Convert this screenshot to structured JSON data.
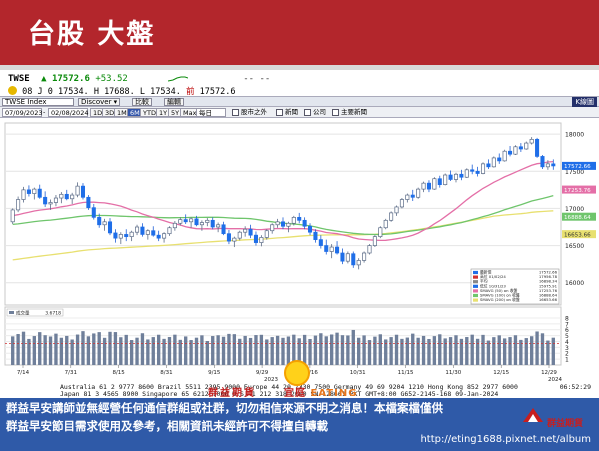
{
  "slide": {
    "title": "台股 大盤"
  },
  "quote": {
    "symbol": "TWSE",
    "last": "17572.6",
    "change": "+53.52",
    "dash": "-- --",
    "line2_prefix": "08 J 0",
    "open_label": "0",
    "open": "17534.",
    "high_label": "H",
    "high": "17688.",
    "low_label": "L",
    "low": "17534.",
    "prev_label": "前",
    "prev": "17572.6"
  },
  "window": {
    "symbol_field": "TWSE Index",
    "discover_button": "Discover",
    "calendar_button": "比較",
    "edit_button": "編輯",
    "k_tab": "K線圖"
  },
  "toolbar": {
    "date_from": "07/09/2023",
    "date_to": "02/08/2024",
    "periods": [
      "1D",
      "3D",
      "1M",
      "6M",
      "YTD",
      "1Y",
      "5Y",
      "Max"
    ],
    "active_period": "6M",
    "frequency": "每日",
    "check1": "股市之外",
    "check2": "新聞",
    "check3": "公司",
    "check4": "主要新聞"
  },
  "chart_data": {
    "type": "candlestick",
    "title": "",
    "price_axis": {
      "ticks": [
        16000,
        16500,
        17000,
        17500,
        18000
      ],
      "ylim": [
        15700,
        18150
      ],
      "labels": [
        "16000",
        "16500",
        "17000",
        "17500",
        "18000"
      ]
    },
    "volume_axis": {
      "ticks": [
        1,
        2,
        3,
        4,
        5,
        6,
        7,
        8
      ],
      "ylim": [
        0,
        8.5
      ],
      "labels": [
        "1",
        "2",
        "3",
        "4",
        "5",
        "6",
        "7",
        "8"
      ]
    },
    "x_labels": [
      "7/14",
      "7/31",
      "8/15",
      "8/31",
      "9/15",
      "9/29",
      "10/16",
      "10/31",
      "11/15",
      "11/30",
      "12/15",
      "12/29"
    ],
    "x_year_labels": [
      "2023",
      "2024"
    ],
    "ohlc": [
      [
        16820,
        17000,
        16790,
        16980
      ],
      [
        16980,
        17160,
        16950,
        17120
      ],
      [
        17120,
        17290,
        17080,
        17250
      ],
      [
        17250,
        17310,
        17160,
        17200
      ],
      [
        17200,
        17280,
        17120,
        17260
      ],
      [
        17260,
        17320,
        17130,
        17150
      ],
      [
        17150,
        17230,
        17020,
        17060
      ],
      [
        17060,
        17120,
        16980,
        17080
      ],
      [
        17080,
        17180,
        17030,
        17140
      ],
      [
        17140,
        17220,
        17070,
        17190
      ],
      [
        17190,
        17250,
        17110,
        17130
      ],
      [
        17130,
        17210,
        17060,
        17180
      ],
      [
        17180,
        17350,
        17150,
        17300
      ],
      [
        17300,
        17340,
        17120,
        17150
      ],
      [
        17150,
        17180,
        16980,
        17010
      ],
      [
        17010,
        17060,
        16850,
        16880
      ],
      [
        16880,
        16930,
        16740,
        16780
      ],
      [
        16780,
        16860,
        16700,
        16820
      ],
      [
        16820,
        16870,
        16640,
        16670
      ],
      [
        16670,
        16720,
        16540,
        16600
      ],
      [
        16600,
        16680,
        16520,
        16650
      ],
      [
        16650,
        16720,
        16560,
        16620
      ],
      [
        16620,
        16700,
        16560,
        16680
      ],
      [
        16680,
        16780,
        16640,
        16750
      ],
      [
        16750,
        16800,
        16620,
        16650
      ],
      [
        16650,
        16720,
        16580,
        16700
      ],
      [
        16700,
        16760,
        16620,
        16640
      ],
      [
        16640,
        16700,
        16560,
        16600
      ],
      [
        16600,
        16680,
        16540,
        16660
      ],
      [
        16660,
        16760,
        16630,
        16740
      ],
      [
        16740,
        16830,
        16700,
        16800
      ],
      [
        16800,
        16880,
        16770,
        16850
      ],
      [
        16850,
        16920,
        16790,
        16820
      ],
      [
        16820,
        16880,
        16740,
        16860
      ],
      [
        16860,
        16900,
        16760,
        16780
      ],
      [
        16780,
        16840,
        16700,
        16810
      ],
      [
        16810,
        16870,
        16760,
        16840
      ],
      [
        16840,
        16880,
        16720,
        16750
      ],
      [
        16750,
        16810,
        16680,
        16780
      ],
      [
        16780,
        16820,
        16640,
        16660
      ],
      [
        16660,
        16710,
        16520,
        16560
      ],
      [
        16560,
        16620,
        16480,
        16600
      ],
      [
        16600,
        16700,
        16570,
        16680
      ],
      [
        16680,
        16760,
        16620,
        16720
      ],
      [
        16720,
        16780,
        16600,
        16640
      ],
      [
        16640,
        16690,
        16500,
        16540
      ],
      [
        16540,
        16640,
        16490,
        16610
      ],
      [
        16610,
        16720,
        16580,
        16700
      ],
      [
        16700,
        16800,
        16660,
        16780
      ],
      [
        16780,
        16860,
        16740,
        16820
      ],
      [
        16820,
        16880,
        16720,
        16760
      ],
      [
        16760,
        16820,
        16680,
        16800
      ],
      [
        16800,
        16900,
        16770,
        16880
      ],
      [
        16880,
        16940,
        16800,
        16840
      ],
      [
        16840,
        16880,
        16720,
        16760
      ],
      [
        16760,
        16800,
        16640,
        16680
      ],
      [
        16680,
        16720,
        16540,
        16580
      ],
      [
        16580,
        16640,
        16460,
        16500
      ],
      [
        16500,
        16580,
        16380,
        16420
      ],
      [
        16420,
        16520,
        16330,
        16480
      ],
      [
        16480,
        16560,
        16380,
        16400
      ],
      [
        16400,
        16460,
        16250,
        16290
      ],
      [
        16290,
        16420,
        16260,
        16390
      ],
      [
        16390,
        16420,
        16200,
        16240
      ],
      [
        16240,
        16330,
        16180,
        16300
      ],
      [
        16300,
        16420,
        16270,
        16400
      ],
      [
        16400,
        16520,
        16380,
        16500
      ],
      [
        16500,
        16640,
        16480,
        16620
      ],
      [
        16620,
        16760,
        16600,
        16740
      ],
      [
        16740,
        16860,
        16720,
        16840
      ],
      [
        16840,
        16960,
        16820,
        16940
      ],
      [
        16940,
        17040,
        16900,
        17020
      ],
      [
        17020,
        17140,
        17000,
        17120
      ],
      [
        17120,
        17200,
        17080,
        17180
      ],
      [
        17180,
        17250,
        17100,
        17150
      ],
      [
        17150,
        17280,
        17130,
        17260
      ],
      [
        17260,
        17360,
        17220,
        17340
      ],
      [
        17340,
        17380,
        17220,
        17260
      ],
      [
        17260,
        17420,
        17250,
        17400
      ],
      [
        17400,
        17440,
        17280,
        17320
      ],
      [
        17320,
        17470,
        17310,
        17450
      ],
      [
        17450,
        17510,
        17370,
        17390
      ],
      [
        17390,
        17480,
        17350,
        17460
      ],
      [
        17460,
        17520,
        17380,
        17420
      ],
      [
        17420,
        17540,
        17410,
        17520
      ],
      [
        17520,
        17590,
        17460,
        17500
      ],
      [
        17500,
        17560,
        17430,
        17470
      ],
      [
        17470,
        17620,
        17460,
        17600
      ],
      [
        17600,
        17660,
        17530,
        17560
      ],
      [
        17560,
        17700,
        17550,
        17680
      ],
      [
        17680,
        17740,
        17600,
        17640
      ],
      [
        17640,
        17790,
        17630,
        17770
      ],
      [
        17770,
        17840,
        17700,
        17730
      ],
      [
        17730,
        17850,
        17720,
        17830
      ],
      [
        17830,
        17880,
        17760,
        17800
      ],
      [
        17800,
        17900,
        17790,
        17880
      ],
      [
        17880,
        17960,
        17860,
        17930
      ],
      [
        17930,
        17950,
        17680,
        17700
      ],
      [
        17700,
        17720,
        17530,
        17560
      ],
      [
        17560,
        17650,
        17520,
        17600
      ],
      [
        17600,
        17660,
        17520,
        17572
      ]
    ],
    "ma_series": [
      {
        "name": "SMAVG (50) on 收盤",
        "color": "#e46fa7"
      },
      {
        "name": "SMAVG (100) on 收盤",
        "color": "#6fc56c"
      },
      {
        "name": "SMAVG (200) on 收盤",
        "color": "#e8e070"
      }
    ],
    "legend": {
      "placement": "bottom-right",
      "rows": [
        {
          "label": "最新價",
          "value": "17572.66"
        },
        {
          "label": "高位 01/02/24",
          "value": "17956.78"
        },
        {
          "label": "平均",
          "value": "16898.34"
        },
        {
          "label": "低位 10/31/23",
          "value": "15975.91"
        },
        {
          "label": "SMAVG (50) on 收盤",
          "value": "17253.76"
        },
        {
          "label": "SMAVG (100) on 收盤",
          "value": "16888.64"
        },
        {
          "label": "SMAVG (200) on 收盤",
          "value": "16653.66"
        }
      ]
    },
    "price_badges": {
      "last": "17572.66",
      "sma50": "17253.76",
      "sma100": "16888.64",
      "sma200": "16653.66"
    },
    "volume_legend": {
      "label": "成交量",
      "value": "3.6718"
    }
  },
  "footer": {
    "line1": "Australia 61 2 9777 8600 Brazil 5511 2395 9000 Europe 44 20 7330 7500 Germany 49 69 9204 1210 Hong Kong 852 2977 6000",
    "line2": "Japan 81 3 4565 8900    Singapore 65 6212 1000    U.S. 1 212 318 2000    SN 128661 PKT  GMT+8:00 G652-2145-168 09-Jan-2024",
    "timestamp": "06:52:29"
  },
  "disclaimer": {
    "line1": "群益早安講師並無經營任何通信群組或社群，切勿相信來源不明之消息！本檔案檔僅供",
    "line2": "群益早安節目需求使用及參考，相關資訊未經許可不得擅自轉載",
    "url": "http://eting1688.pixnet.net/album"
  },
  "program_logo": {
    "left_text": "群益期貨",
    "right_text": "宜庭",
    "eating": "EATING"
  },
  "corp_logo": {
    "name": "群益期貨"
  }
}
